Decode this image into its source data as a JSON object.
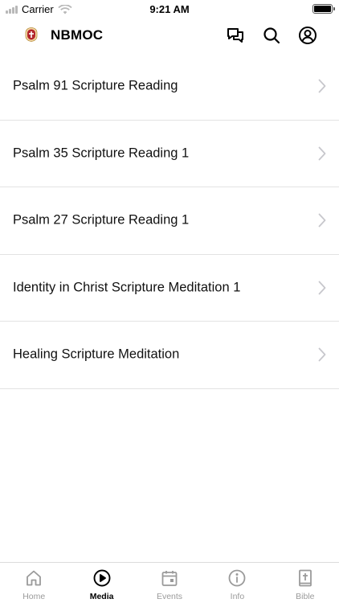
{
  "status_bar": {
    "carrier": "Carrier",
    "time": "9:21 AM"
  },
  "header": {
    "title": "NBMOC",
    "icons": [
      "chat-icon",
      "search-icon",
      "profile-icon"
    ]
  },
  "media_list": {
    "items": [
      {
        "label": "Psalm 91 Scripture Reading"
      },
      {
        "label": "Psalm 35 Scripture Reading 1"
      },
      {
        "label": "Psalm 27 Scripture Reading 1"
      },
      {
        "label": "Identity in Christ Scripture Meditation 1"
      },
      {
        "label": "Healing Scripture Meditation"
      }
    ]
  },
  "tab_bar": {
    "active": "Media",
    "tabs": [
      {
        "label": "Home",
        "icon": "home-icon"
      },
      {
        "label": "Media",
        "icon": "play-circle-icon"
      },
      {
        "label": "Events",
        "icon": "calendar-icon"
      },
      {
        "label": "Info",
        "icon": "info-icon"
      },
      {
        "label": "Bible",
        "icon": "bible-icon"
      }
    ]
  },
  "colors": {
    "active_tab": "#000000",
    "inactive_tab": "#9a9a9a",
    "divider": "#e3e3e3",
    "chevron": "#c7c7cc"
  }
}
